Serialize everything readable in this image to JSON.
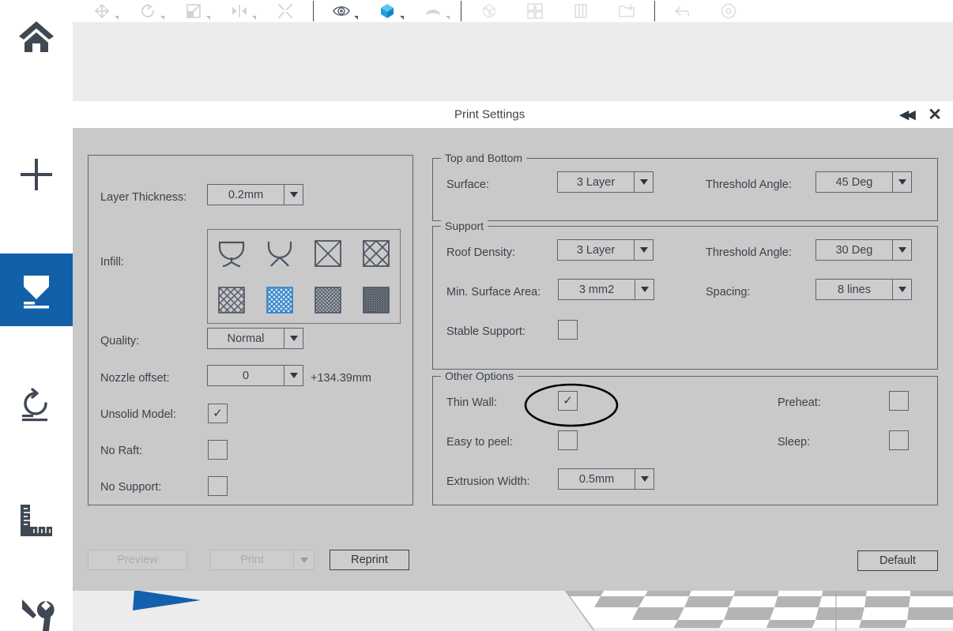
{
  "app": {
    "sidebar": {
      "items": [
        {
          "name": "home",
          "icon": "home-icon",
          "active": false
        },
        {
          "name": "add",
          "icon": "plus-icon",
          "active": false
        },
        {
          "name": "print",
          "icon": "print-extrude-icon",
          "active": true
        },
        {
          "name": "rotate",
          "icon": "rotate-icon",
          "active": false
        },
        {
          "name": "measure",
          "icon": "ruler-icon",
          "active": false
        },
        {
          "name": "tools",
          "icon": "wrench-screwdriver-icon",
          "active": false
        }
      ]
    },
    "toolbar": {
      "buttons": [
        {
          "name": "move",
          "icon": "move-arrows-icon",
          "has_caret": true,
          "enabled": false
        },
        {
          "name": "rotate",
          "icon": "rotate-arrow-icon",
          "has_caret": true,
          "enabled": false
        },
        {
          "name": "scale",
          "icon": "scale-icon",
          "has_caret": true,
          "enabled": false
        },
        {
          "name": "mirror",
          "icon": "mirror-icon",
          "has_caret": true,
          "enabled": false
        },
        {
          "name": "shrink",
          "icon": "shrink-icon",
          "has_caret": false,
          "enabled": false
        },
        {
          "name": "view-eye",
          "icon": "eye-icon",
          "has_caret": true,
          "enabled": true
        },
        {
          "name": "solid-view",
          "icon": "cube-icon",
          "has_caret": true,
          "enabled": true
        },
        {
          "name": "shell-view",
          "icon": "shell-icon",
          "has_caret": true,
          "enabled": false
        },
        {
          "name": "perspective",
          "icon": "wire-cube-icon",
          "has_caret": false,
          "enabled": false
        },
        {
          "name": "grid-view",
          "icon": "grid-icon",
          "has_caret": false,
          "enabled": false
        },
        {
          "name": "column-view",
          "icon": "column-icon",
          "has_caret": false,
          "enabled": false
        },
        {
          "name": "export",
          "icon": "export-folder-icon",
          "has_caret": false,
          "enabled": false
        },
        {
          "name": "undo",
          "icon": "undo-arrow-icon",
          "has_caret": false,
          "enabled": false
        },
        {
          "name": "reset-view",
          "icon": "reset-view-icon",
          "has_caret": false,
          "enabled": false
        }
      ]
    }
  },
  "dialog": {
    "title": "Print Settings",
    "collapse_glyph": "◀◀",
    "close_glyph": "✕",
    "left_panel": {
      "layer_thickness": {
        "label": "Layer Thickness:",
        "value": "0.2mm"
      },
      "infill": {
        "label": "Infill:",
        "options": [
          {
            "name": "infill-goblet",
            "selected": false
          },
          {
            "name": "infill-split-goblet",
            "selected": false
          },
          {
            "name": "infill-cross-square",
            "selected": false
          },
          {
            "name": "infill-diamond-lattice",
            "selected": false
          },
          {
            "name": "infill-hatch-low",
            "selected": false
          },
          {
            "name": "infill-hatch-medium",
            "selected": true
          },
          {
            "name": "infill-hatch-high",
            "selected": false
          },
          {
            "name": "infill-hatch-solid",
            "selected": false
          }
        ]
      },
      "quality": {
        "label": "Quality:",
        "value": "Normal"
      },
      "nozzle_offset": {
        "label": "Nozzle offset:",
        "value": "0",
        "suffix": "+134.39mm"
      },
      "unsolid_model": {
        "label": "Unsolid Model:",
        "checked": true,
        "mark": "✓"
      },
      "no_raft": {
        "label": "No Raft:",
        "checked": false,
        "mark": "✓"
      },
      "no_support": {
        "label": "No Support:",
        "checked": false,
        "mark": "✓"
      }
    },
    "top_and_bottom": {
      "legend": "Top and Bottom",
      "surface": {
        "label": "Surface:",
        "value": "3 Layer"
      },
      "threshold_angle": {
        "label": "Threshold Angle:",
        "value": "45 Deg"
      }
    },
    "support": {
      "legend": "Support",
      "roof_density": {
        "label": "Roof Density:",
        "value": "3 Layer"
      },
      "threshold_angle": {
        "label": "Threshold Angle:",
        "value": "30 Deg"
      },
      "min_surface_area": {
        "label": "Min. Surface Area:",
        "value": "3 mm2"
      },
      "spacing": {
        "label": "Spacing:",
        "value": "8 lines"
      },
      "stable_support": {
        "label": "Stable Support:",
        "checked": false,
        "mark": "✓"
      }
    },
    "other_options": {
      "legend": "Other Options",
      "thin_wall": {
        "label": "Thin Wall:",
        "checked": true,
        "mark": "✓"
      },
      "preheat": {
        "label": "Preheat:",
        "checked": false,
        "mark": "✓"
      },
      "easy_to_peel": {
        "label": "Easy to peel:",
        "checked": false,
        "mark": "✓"
      },
      "sleep": {
        "label": "Sleep:",
        "checked": false,
        "mark": "✓"
      },
      "extrusion_width": {
        "label": "Extrusion Width:",
        "value": "0.5mm"
      }
    },
    "footer": {
      "preview": {
        "label": "Preview",
        "enabled": false
      },
      "print": {
        "label": "Print",
        "enabled": false
      },
      "reprint": {
        "label": "Reprint",
        "enabled": true
      },
      "default": {
        "label": "Default",
        "enabled": true
      }
    }
  },
  "annotation": {
    "shape": "ellipse",
    "target": "thin-wall-checkbox",
    "color": "#000000"
  },
  "colors": {
    "accent_blue": "#1260a8",
    "toolbar_active_blue": "#29a8e0",
    "dialog_bg": "#c9c9c9",
    "viewport_bg": "#ececec",
    "text": "#3a424c",
    "border": "#5a6370",
    "cursor_blue": "#1460ac"
  }
}
